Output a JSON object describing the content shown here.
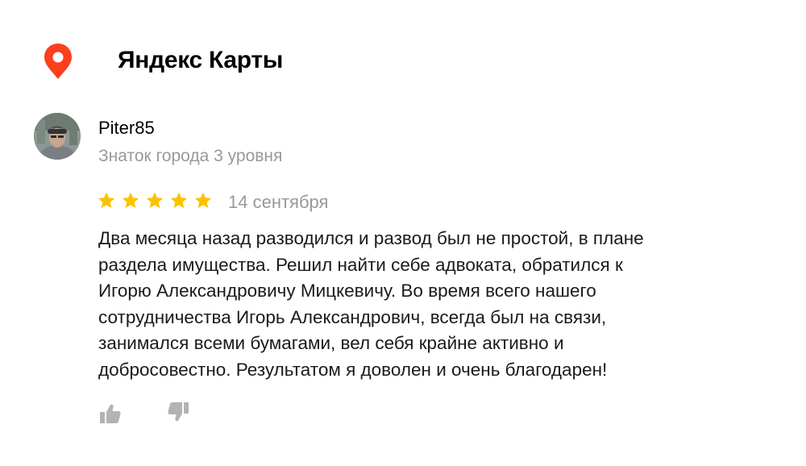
{
  "header": {
    "brand": "Яндекс Карты",
    "pin_icon": "map-pin-icon",
    "pin_color": "#fc3f1d"
  },
  "review": {
    "author": "Piter85",
    "author_level": "Знаток города 3 уровня",
    "rating": 5,
    "rating_max": 5,
    "star_color": "#fcc200",
    "date": "14 сентября",
    "text_lines": [
      "Два месяца назад разводился и развод был не простой, в плане",
      "раздела имущества. Решил найти себе адвоката, обратился к",
      "Игорю Александровичу Мицкевичу. Во время всего нашего",
      "сотрудничества Игорь Александрович, всегда был на связи,",
      "занимался всеми бумагами, вел себя крайне активно и",
      "добросовестно. Результатом я доволен и очень благодарен!"
    ]
  },
  "actions": {
    "like_icon": "thumbs-up-icon",
    "dislike_icon": "thumbs-down-icon",
    "icon_color": "#b3b3b3"
  }
}
